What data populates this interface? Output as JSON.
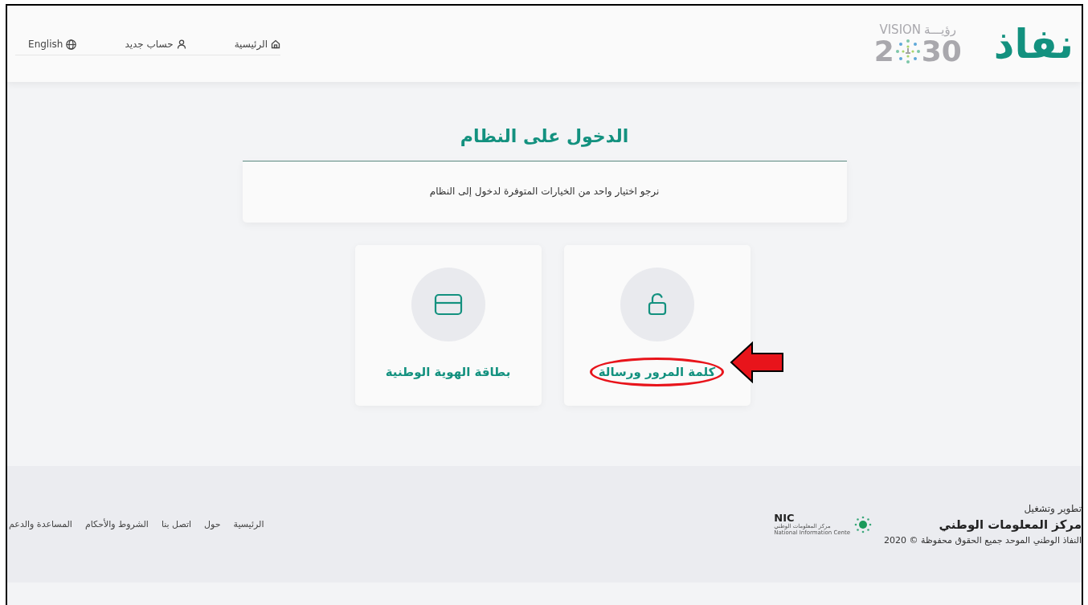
{
  "header": {
    "logo": "نفاذ",
    "vision_logo": {
      "vision": "VISION",
      "ruya": "رؤيـــة",
      "year_start": "2",
      "year_end": "30"
    },
    "nav": [
      {
        "label": "الرئيسية",
        "kind": "home"
      },
      {
        "label": "حساب جديد",
        "kind": "user"
      },
      {
        "label": "English",
        "kind": "globe"
      }
    ]
  },
  "login": {
    "title": "الدخول على النظام",
    "message": "نرجو اختيار واحد من الخيارات المتوفرة لدخول إلى النظام",
    "methods": [
      {
        "label": "كلمة المرور ورسالة",
        "kind": "lock",
        "highlighted": true
      },
      {
        "label": "بطاقة الهوية الوطنية",
        "kind": "card",
        "highlighted": false
      }
    ]
  },
  "footer": {
    "developed_by": "تطوير وتشغيل",
    "org": "مركز المعلومات الوطني",
    "copyright": "النفاذ الوطني الموحد جميع الحقوق محفوظة © 2020",
    "nic_logo": {
      "abbr": "NIC",
      "arabic": "مركز المعلومات الوطني",
      "english": "National Information Cente"
    },
    "links": [
      "الرئيسية",
      "حول",
      "اتصل بنا",
      "الشروط والأحكام",
      "المساعدة والدعم"
    ]
  }
}
